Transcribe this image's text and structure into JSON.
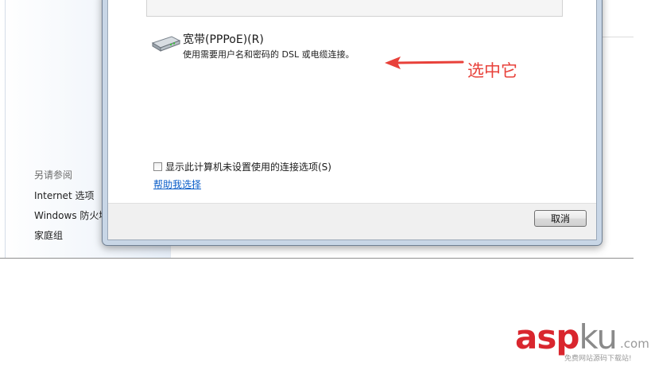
{
  "sidebar": {
    "title": "另请参阅",
    "links": [
      {
        "label": "Internet 选项"
      },
      {
        "label": "Windows 防火墙"
      },
      {
        "label": "家庭组"
      }
    ]
  },
  "dialog": {
    "option": {
      "icon": "modem-icon",
      "title": "宽带(PPPoE)(R)",
      "description": "使用需要用户名和密码的 DSL 或电缆连接。"
    },
    "checkbox": {
      "label": "显示此计算机未设置使用的连接选项(S)",
      "checked": false
    },
    "help_link": "帮助我选择",
    "cancel_label": "取消"
  },
  "annotation": {
    "text": "选中它",
    "color": "#e8413a"
  },
  "watermark": {
    "brand_red": "asp",
    "brand_gray": "ku",
    "suffix": ".com",
    "subtitle": "免费网站源码下载站!"
  }
}
